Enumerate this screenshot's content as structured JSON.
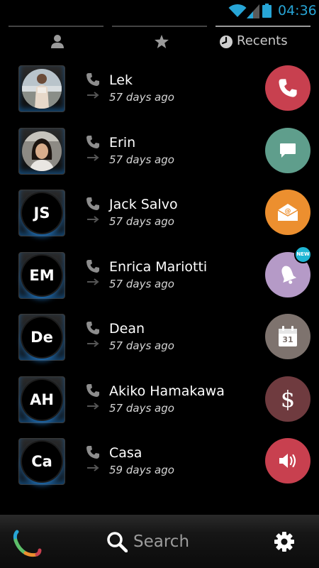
{
  "status_bar": {
    "time": "04:36"
  },
  "tabs": [
    {
      "icon": "person-icon"
    },
    {
      "icon": "star-icon"
    },
    {
      "icon": "clock-icon",
      "label": "Recents",
      "active": true
    }
  ],
  "contacts": [
    {
      "name": "Lek",
      "time": "57 days ago",
      "avatar": "photo",
      "action": "call",
      "action_color": "#c8404f"
    },
    {
      "name": "Erin",
      "time": "57 days ago",
      "avatar": "photo",
      "action": "message",
      "action_color": "#5f9e8c"
    },
    {
      "name": "Jack Salvo",
      "initials": "JS",
      "time": "57 days ago",
      "action": "email",
      "action_color": "#ec8f2f"
    },
    {
      "name": "Enrica Mariotti",
      "initials": "EM",
      "time": "57 days ago",
      "action": "reminder",
      "action_color": "#b59ac7",
      "badge": "NEW"
    },
    {
      "name": "Dean",
      "initials": "De",
      "time": "57 days ago",
      "action": "calendar",
      "action_color": "#7e736e",
      "calendar_day": "31"
    },
    {
      "name": "Akiko Hamakawa",
      "initials": "AH",
      "time": "57 days ago",
      "action": "payment",
      "action_color": "#6f3b3f",
      "symbol": "$"
    },
    {
      "name": "Casa",
      "initials": "Ca",
      "time": "59 days ago",
      "action": "speaker",
      "action_color": "#c8404f"
    }
  ],
  "bottom_bar": {
    "search_placeholder": "Search"
  }
}
